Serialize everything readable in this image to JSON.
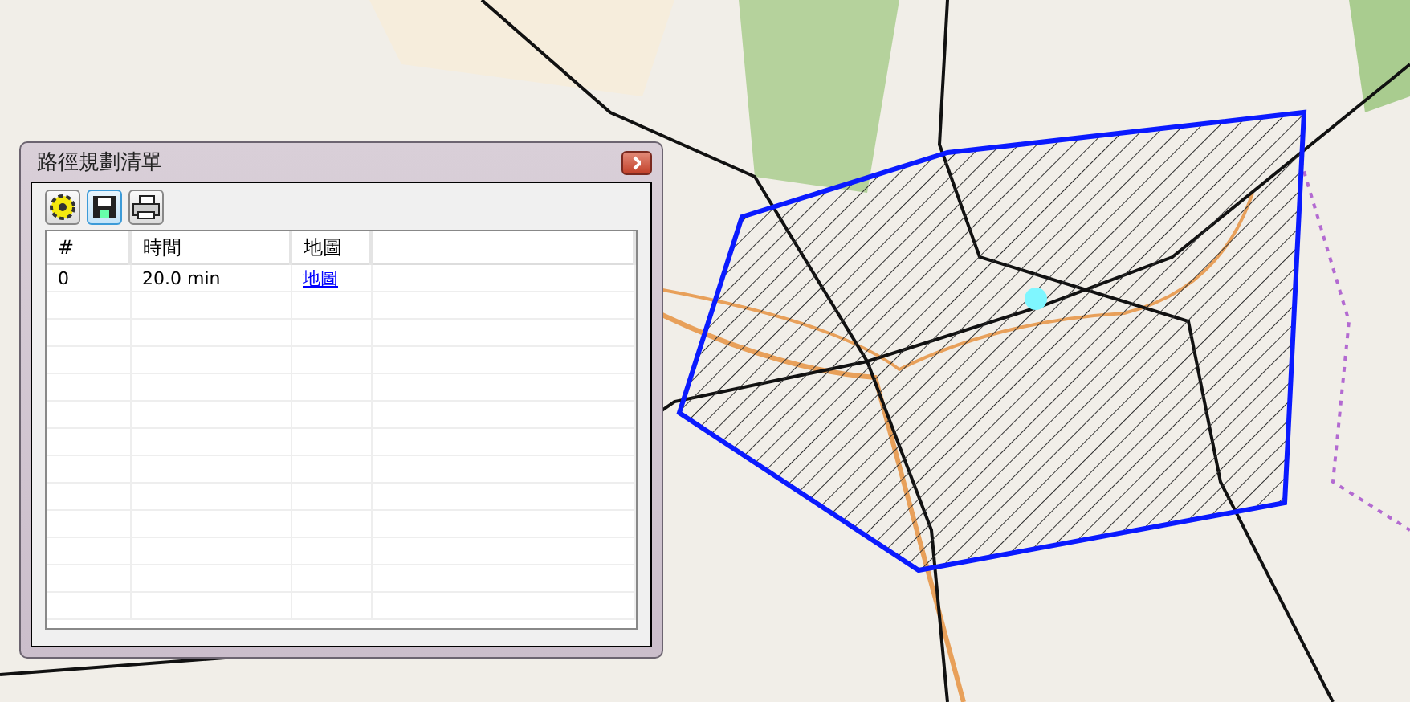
{
  "window": {
    "title": "路徑規劃清單"
  },
  "table": {
    "columns": [
      "#",
      "時間",
      "地圖"
    ],
    "rows": [
      {
        "index": "0",
        "time": "20.0 min",
        "map_link": "地圖"
      }
    ]
  }
}
